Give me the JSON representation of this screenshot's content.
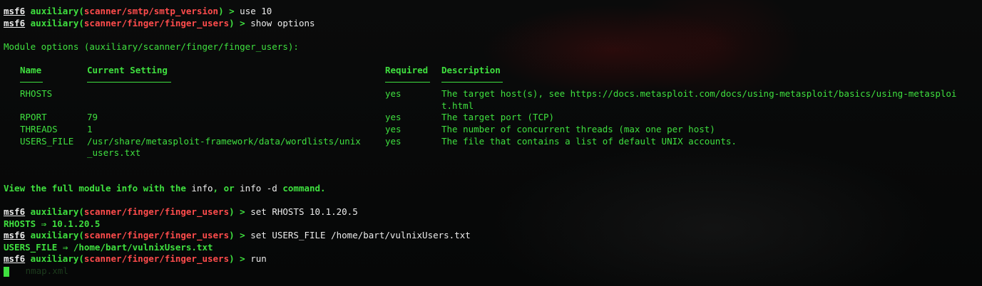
{
  "terminal": {
    "prompt": "msf6",
    "lines": [
      {
        "module": "scanner/smtp/smtp_version",
        "command": "use 10"
      },
      {
        "module": "scanner/finger/finger_users",
        "command": "show options"
      }
    ],
    "module_options_heading": "Module options (auxiliary/scanner/finger/finger_users):",
    "columns": {
      "name": "Name",
      "current_setting": "Current Setting",
      "required": "Required",
      "description": "Description"
    },
    "options": [
      {
        "name": "RHOSTS",
        "setting": "",
        "setting_cont": "",
        "required": "yes",
        "description": "The target host(s), see https://docs.metasploit.com/docs/using-metasploit/basics/using-metasploi",
        "description_cont": "t.html"
      },
      {
        "name": "RPORT",
        "setting": "79",
        "setting_cont": "",
        "required": "yes",
        "description": "The target port (TCP)",
        "description_cont": ""
      },
      {
        "name": "THREADS",
        "setting": "1",
        "setting_cont": "",
        "required": "yes",
        "description": "The number of concurrent threads (max one per host)",
        "description_cont": ""
      },
      {
        "name": "USERS_FILE",
        "setting": "/usr/share/metasploit-framework/data/wordlists/unix",
        "setting_cont": "_users.txt",
        "required": "yes",
        "description": "The file that contains a list of default UNIX accounts.",
        "description_cont": ""
      }
    ],
    "info_line": {
      "pre": "View the full module info with the ",
      "info": "info",
      "mid": ", or ",
      "info_d": "info -d",
      "post": " command."
    },
    "later_lines": [
      {
        "module": "scanner/finger/finger_users",
        "command": "set RHOSTS 10.1.20.5"
      },
      {
        "output": "RHOSTS ⇒ 10.1.20.5"
      },
      {
        "module": "scanner/finger/finger_users",
        "command": "set USERS_FILE /home/bart/vulnixUsers.txt"
      },
      {
        "output": "USERS_FILE ⇒ /home/bart/vulnixUsers.txt"
      },
      {
        "module": "scanner/finger/finger_users",
        "command": "run"
      }
    ],
    "auxiliary_word": "auxiliary",
    "suffix": " > ",
    "bg_faint_text": "nmap.xml"
  }
}
